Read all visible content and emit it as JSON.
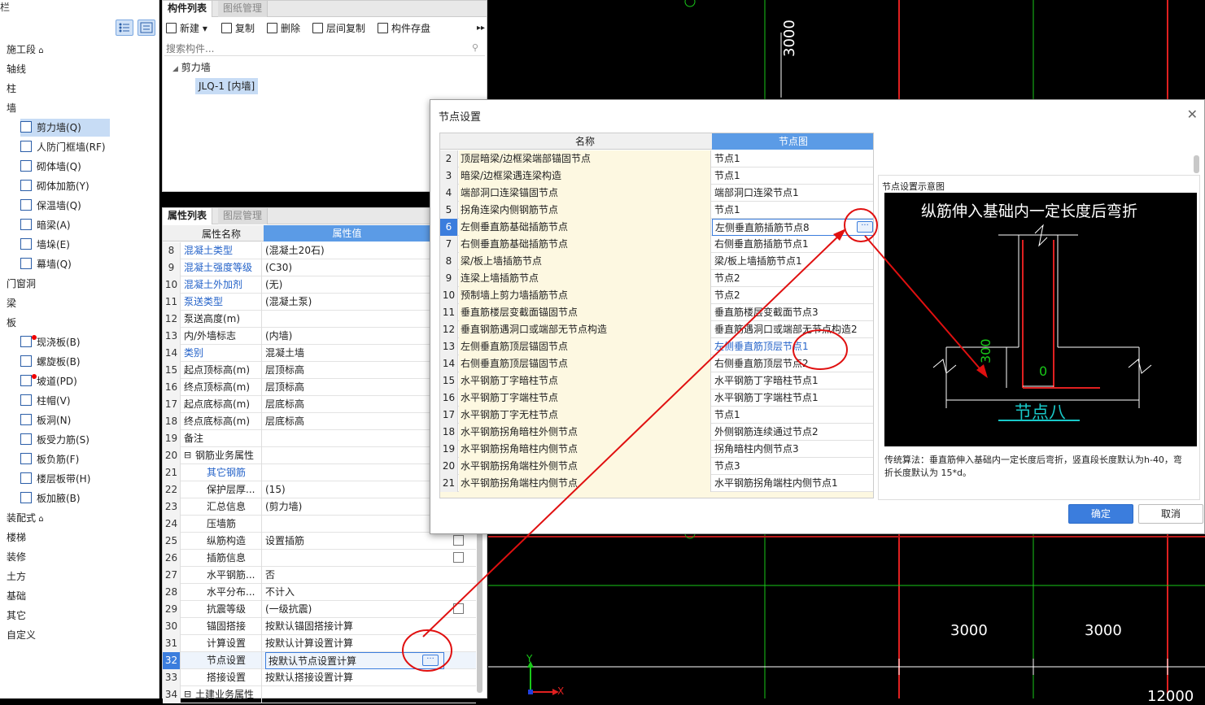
{
  "nav": {
    "title": "导航栏",
    "items": [
      {
        "label": "施工段",
        "indent": 0,
        "lock": true
      },
      {
        "label": "轴线",
        "indent": 0
      },
      {
        "label": "柱",
        "indent": 0
      },
      {
        "label": "墙",
        "indent": 0
      },
      {
        "label": "剪力墙(Q)",
        "indent": 1,
        "selected": true
      },
      {
        "label": "人防门框墙(RF)",
        "indent": 1
      },
      {
        "label": "砌体墙(Q)",
        "indent": 1
      },
      {
        "label": "砌体加筋(Y)",
        "indent": 1
      },
      {
        "label": "保温墙(Q)",
        "indent": 1
      },
      {
        "label": "暗梁(A)",
        "indent": 1
      },
      {
        "label": "墙垛(E)",
        "indent": 1
      },
      {
        "label": "幕墙(Q)",
        "indent": 1
      },
      {
        "label": "门窗洞",
        "indent": 0
      },
      {
        "label": "梁",
        "indent": 0
      },
      {
        "label": "板",
        "indent": 0
      },
      {
        "label": "现浇板(B)",
        "indent": 1,
        "dot": true
      },
      {
        "label": "螺旋板(B)",
        "indent": 1
      },
      {
        "label": "坡道(PD)",
        "indent": 1,
        "dot": true
      },
      {
        "label": "柱帽(V)",
        "indent": 1
      },
      {
        "label": "板洞(N)",
        "indent": 1
      },
      {
        "label": "板受力筋(S)",
        "indent": 1
      },
      {
        "label": "板负筋(F)",
        "indent": 1
      },
      {
        "label": "楼层板带(H)",
        "indent": 1
      },
      {
        "label": "板加腋(B)",
        "indent": 1
      },
      {
        "label": "装配式",
        "indent": 0,
        "lock": true
      },
      {
        "label": "楼梯",
        "indent": 0
      },
      {
        "label": "装修",
        "indent": 0
      },
      {
        "label": "土方",
        "indent": 0
      },
      {
        "label": "基础",
        "indent": 0
      },
      {
        "label": "其它",
        "indent": 0
      },
      {
        "label": "自定义",
        "indent": 0
      }
    ]
  },
  "component": {
    "tab_active": "构件列表",
    "tab_other": "图纸管理",
    "toolbar": {
      "new": "新建",
      "copy": "复制",
      "delete": "删除",
      "floor_copy": "层间复制",
      "save": "构件存盘"
    },
    "search_placeholder": "搜索构件...",
    "tree_root": "剪力墙",
    "tree_child": "JLQ-1 [内墙]"
  },
  "props": {
    "tab_active": "属性列表",
    "tab_other": "图层管理",
    "header_name": "属性名称",
    "header_value": "属性值",
    "rows": [
      {
        "n": "8",
        "k": "混凝土类型",
        "v": "(混凝土20石)",
        "blue": true
      },
      {
        "n": "9",
        "k": "混凝土强度等级",
        "v": "(C30)",
        "blue": true
      },
      {
        "n": "10",
        "k": "混凝土外加剂",
        "v": "(无)",
        "blue": true
      },
      {
        "n": "11",
        "k": "泵送类型",
        "v": "(混凝土泵)",
        "blue": true
      },
      {
        "n": "12",
        "k": "泵送高度(m)",
        "v": ""
      },
      {
        "n": "13",
        "k": "内/外墙标志",
        "v": "(内墙)"
      },
      {
        "n": "14",
        "k": "类别",
        "v": "混凝土墙",
        "blue": true
      },
      {
        "n": "15",
        "k": "起点顶标高(m)",
        "v": "层顶标高"
      },
      {
        "n": "16",
        "k": "终点顶标高(m)",
        "v": "层顶标高"
      },
      {
        "n": "17",
        "k": "起点底标高(m)",
        "v": "层底标高"
      },
      {
        "n": "18",
        "k": "终点底标高(m)",
        "v": "层底标高"
      },
      {
        "n": "19",
        "k": "备注",
        "v": ""
      },
      {
        "n": "20",
        "k": "钢筋业务属性",
        "v": "",
        "group": true
      },
      {
        "n": "21",
        "k": "其它钢筋",
        "v": "",
        "blue": true,
        "sub": true
      },
      {
        "n": "22",
        "k": "保护层厚...",
        "v": "(15)",
        "sub": true
      },
      {
        "n": "23",
        "k": "汇总信息",
        "v": "(剪力墙)",
        "sub": true
      },
      {
        "n": "24",
        "k": "压墙筋",
        "v": "",
        "sub": true
      },
      {
        "n": "25",
        "k": "纵筋构造",
        "v": "设置插筋",
        "sub": true,
        "chk": true
      },
      {
        "n": "26",
        "k": "插筋信息",
        "v": "",
        "sub": true,
        "chk": true
      },
      {
        "n": "27",
        "k": "水平钢筋...",
        "v": "否",
        "sub": true
      },
      {
        "n": "28",
        "k": "水平分布...",
        "v": "不计入",
        "sub": true
      },
      {
        "n": "29",
        "k": "抗震等级",
        "v": "(一级抗震)",
        "sub": true,
        "chk": true
      },
      {
        "n": "30",
        "k": "锚固搭接",
        "v": "按默认锚固搭接计算",
        "sub": true
      },
      {
        "n": "31",
        "k": "计算设置",
        "v": "按默认计算设置计算",
        "sub": true
      },
      {
        "n": "32",
        "k": "节点设置",
        "v": "按默认节点设置计算",
        "sub": true,
        "sel": true
      },
      {
        "n": "33",
        "k": "搭接设置",
        "v": "按默认搭接设置计算",
        "sub": true
      },
      {
        "n": "34",
        "k": "土建业务属性",
        "v": "",
        "group": true
      }
    ]
  },
  "cad": {
    "dim_vertical": "3000",
    "dim_bottom_1": "3000",
    "dim_bottom_2": "3000",
    "dim_corner": "12000",
    "axis_y": "Y",
    "axis_x": "X"
  },
  "dialog": {
    "title": "节点设置",
    "col_name": "名称",
    "col_node": "节点图",
    "rows": [
      {
        "n": "2",
        "k": "顶层暗梁/边框梁端部锚固节点",
        "v": "节点1"
      },
      {
        "n": "3",
        "k": "暗梁/边框梁遇连梁构造",
        "v": "节点1"
      },
      {
        "n": "4",
        "k": "端部洞口连梁锚固节点",
        "v": "端部洞口连梁节点1"
      },
      {
        "n": "5",
        "k": "拐角连梁内侧钢筋节点",
        "v": "节点1"
      },
      {
        "n": "6",
        "k": "左侧垂直筋基础插筋节点",
        "v": "左侧垂直筋插筋节点8",
        "sel": true
      },
      {
        "n": "7",
        "k": "右侧垂直筋基础插筋节点",
        "v": "右侧垂直筋插筋节点1"
      },
      {
        "n": "8",
        "k": "梁/板上墙插筋节点",
        "v": "梁/板上墙插筋节点1"
      },
      {
        "n": "9",
        "k": "连梁上墙插筋节点",
        "v": "节点2"
      },
      {
        "n": "10",
        "k": "预制墙上剪力墙插筋节点",
        "v": "节点2"
      },
      {
        "n": "11",
        "k": "垂直筋楼层变截面锚固节点",
        "v": "垂直筋楼层变截面节点3"
      },
      {
        "n": "12",
        "k": "垂直钢筋遇洞口或端部无节点构造",
        "v": "垂直筋遇洞口或端部无节点构造2"
      },
      {
        "n": "13",
        "k": "左侧垂直筋顶层锚固节点",
        "v": "左侧垂直筋顶层节点1",
        "blue": true
      },
      {
        "n": "14",
        "k": "右侧垂直筋顶层锚固节点",
        "v": "右侧垂直筋顶层节点2"
      },
      {
        "n": "15",
        "k": "水平钢筋丁字暗柱节点",
        "v": "水平钢筋丁字暗柱节点1"
      },
      {
        "n": "16",
        "k": "水平钢筋丁字端柱节点",
        "v": "水平钢筋丁字端柱节点1"
      },
      {
        "n": "17",
        "k": "水平钢筋丁字无柱节点",
        "v": "节点1"
      },
      {
        "n": "18",
        "k": "水平钢筋拐角暗柱外侧节点",
        "v": "外侧钢筋连续通过节点2"
      },
      {
        "n": "19",
        "k": "水平钢筋拐角暗柱内侧节点",
        "v": "拐角暗柱内侧节点3"
      },
      {
        "n": "20",
        "k": "水平钢筋拐角端柱外侧节点",
        "v": "节点3"
      },
      {
        "n": "21",
        "k": "水平钢筋拐角端柱内侧节点",
        "v": "水平钢筋拐角端柱内侧节点1"
      }
    ],
    "preview_title": "节点设置示意图",
    "diagram_heading": "纵筋伸入基础内一定长度后弯折",
    "diagram_dim_300": "300",
    "diagram_dim_0": "0",
    "diagram_caption": "节点八",
    "description": "传统算法：垂直筋伸入基础内一定长度后弯折，竖直段长度默认为h-40，弯折长度默认为 15*d。",
    "ok": "确定",
    "cancel": "取消"
  },
  "colors": {
    "accent": "#3b7ddd",
    "annotation": "#e01010",
    "cad_green": "#19c819",
    "cad_red": "#e02020"
  }
}
